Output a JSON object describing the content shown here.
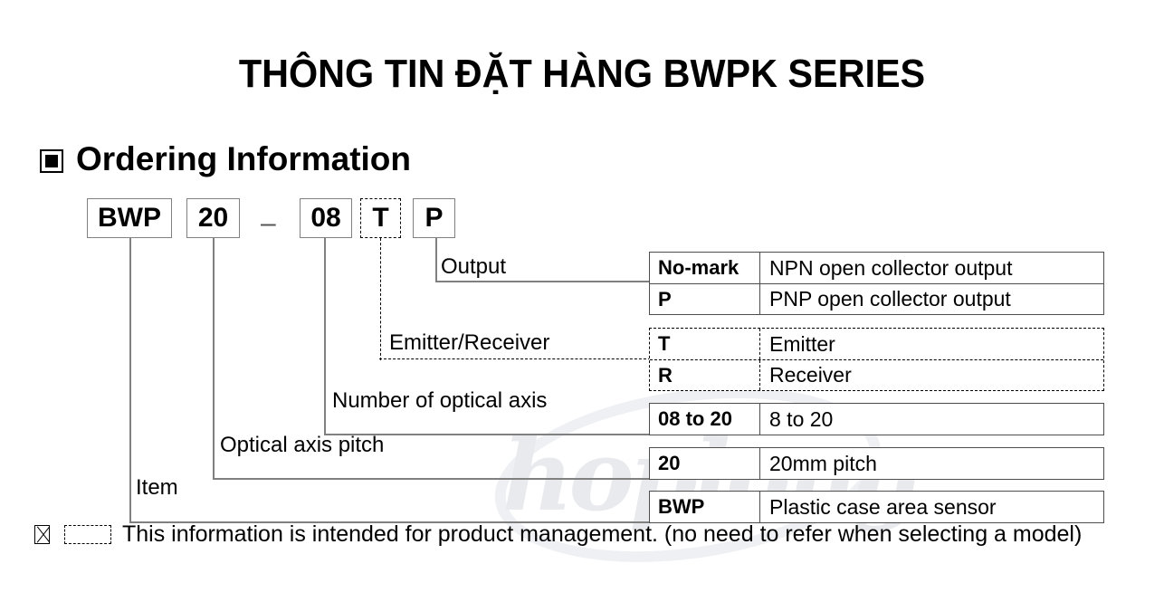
{
  "document": {
    "title": "THÔNG TIN ĐẶT HÀNG BWPK SERIES",
    "section_heading": "Ordering Information",
    "bullet_icon": "filled-square-icon"
  },
  "part_code": {
    "separator": "–",
    "segments": [
      {
        "label": "BWP",
        "style": "solid"
      },
      {
        "label": "20",
        "style": "solid"
      },
      {
        "label": "08",
        "style": "solid"
      },
      {
        "label": "T",
        "style": "dotted"
      },
      {
        "label": "P",
        "style": "solid"
      }
    ]
  },
  "leaders": {
    "output": "Output",
    "emitter_receiver": "Emitter/Receiver",
    "number_of_optical_axis": "Number of optical axis",
    "optical_axis_pitch": "Optical axis pitch",
    "item": "Item"
  },
  "tables": {
    "output": {
      "style": "solid",
      "rows": [
        {
          "code": "No-mark",
          "desc": "NPN open collector output"
        },
        {
          "code": "P",
          "desc": "PNP open collector output"
        }
      ]
    },
    "emitter_receiver": {
      "style": "dotted",
      "rows": [
        {
          "code": "T",
          "desc": "Emitter"
        },
        {
          "code": "R",
          "desc": "Receiver"
        }
      ]
    },
    "number_of_optical_axis": {
      "style": "solid",
      "rows": [
        {
          "code": "08 to 20",
          "desc": "8 to 20"
        }
      ]
    },
    "optical_axis_pitch": {
      "style": "solid",
      "rows": [
        {
          "code": "20",
          "desc": "20mm pitch"
        }
      ]
    },
    "item": {
      "style": "solid",
      "rows": [
        {
          "code": "BWP",
          "desc": "Plastic case area sensor"
        }
      ]
    }
  },
  "footnote": {
    "marker_icon": "missing-glyph-box-icon",
    "sample_box_icon": "dotted-box-icon",
    "text": "This information is intended for product management. (no need to refer when selecting a model)"
  },
  "watermark": {
    "text": "hoplong"
  },
  "colors": {
    "ink": "#000000",
    "rule": "#4d4d4d",
    "box_border": "#808080",
    "watermark": "#e9eaee",
    "background": "#ffffff"
  }
}
